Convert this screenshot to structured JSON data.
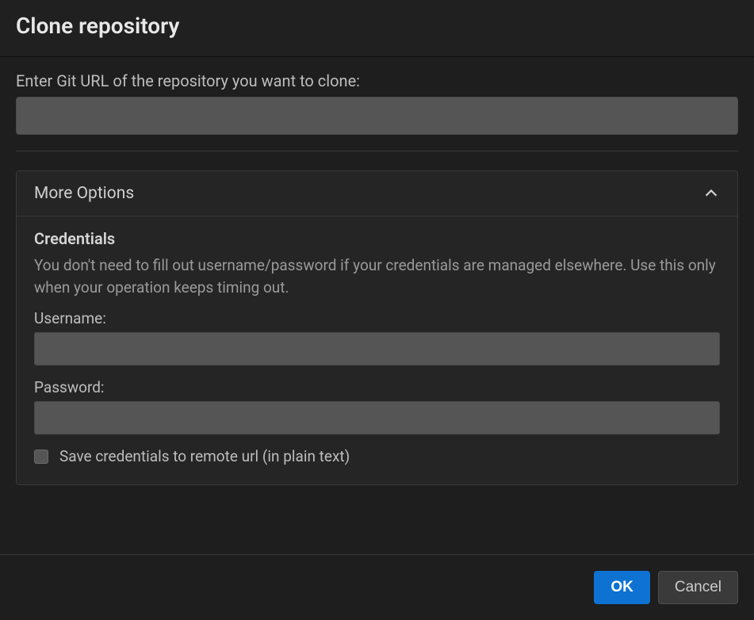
{
  "dialog": {
    "title": "Clone repository"
  },
  "url_section": {
    "label": "Enter Git URL of the repository you want to clone:",
    "value": ""
  },
  "more_options": {
    "header": "More Options",
    "expanded": true,
    "credentials": {
      "title": "Credentials",
      "description": "You don't need to fill out username/password if your credentials are managed elsewhere. Use this only when your operation keeps timing out.",
      "username_label": "Username:",
      "username_value": "",
      "password_label": "Password:",
      "password_value": "",
      "save_checkbox_label": "Save credentials to remote url (in plain text)",
      "save_checked": false
    }
  },
  "footer": {
    "ok": "OK",
    "cancel": "Cancel"
  }
}
